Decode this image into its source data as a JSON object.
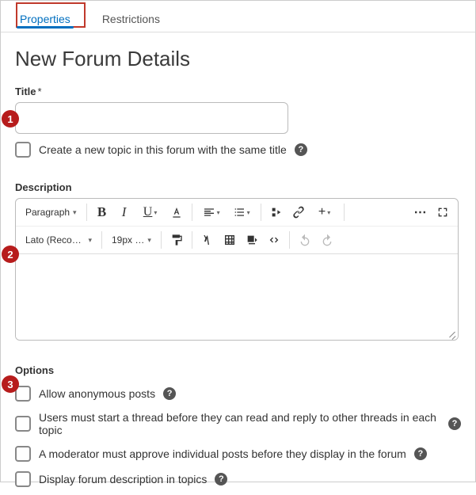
{
  "tabs": {
    "properties": "Properties",
    "restrictions": "Restrictions"
  },
  "heading": "New Forum Details",
  "title_field": {
    "label": "Title",
    "required": "*",
    "value": ""
  },
  "create_topic_checkbox": "Create a new topic in this forum with the same title",
  "description_label": "Description",
  "toolbar": {
    "block": "Paragraph",
    "font": "Lato (Recom…",
    "size": "19px …",
    "more": "⋯"
  },
  "options_label": "Options",
  "options": {
    "anon": "Allow anonymous posts",
    "must_start": "Users must start a thread before they can read and reply to other threads in each topic",
    "moderate": "A moderator must approve individual posts before they display in the forum",
    "display_desc": "Display forum description in topics"
  },
  "callouts": {
    "1": "1",
    "2": "2",
    "3": "3"
  }
}
